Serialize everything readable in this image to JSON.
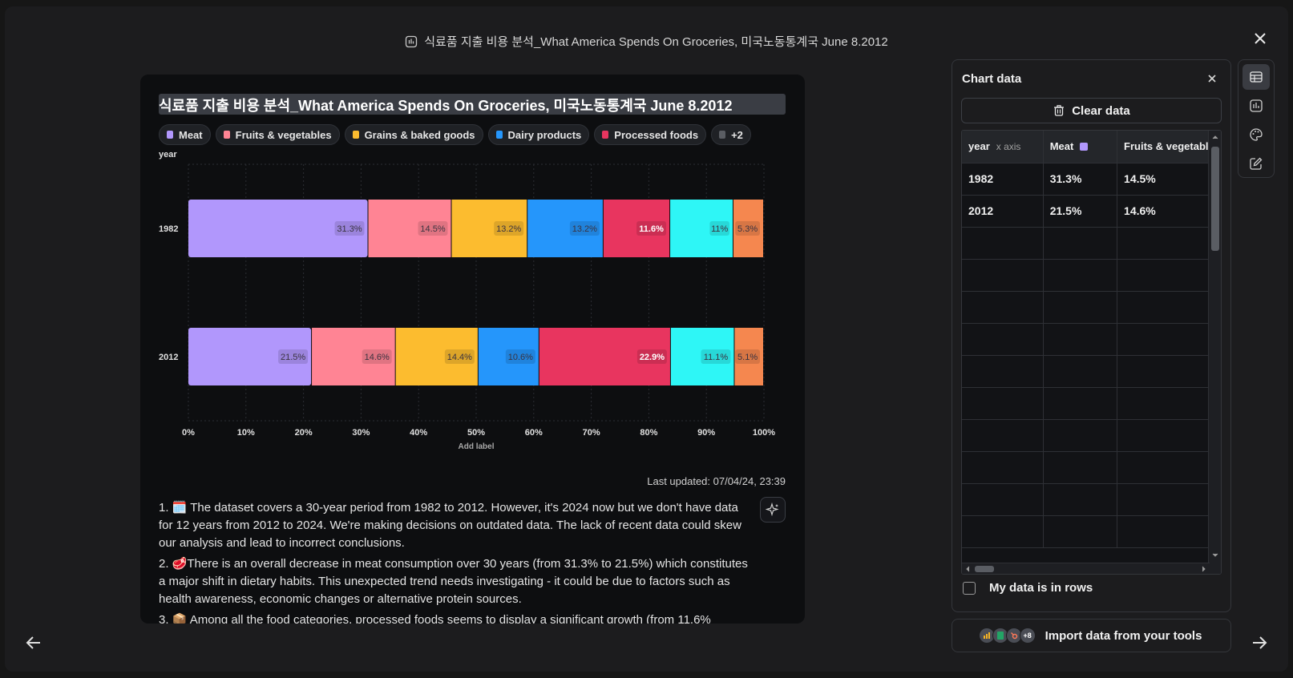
{
  "modal": {
    "title": "식료품 지출 비용 분석_What America Spends On Groceries, 미국노동통계국 June 8.2012"
  },
  "chart": {
    "title": "식료품 지출 비용 분석_What America Spends On Groceries, 미국노동통계국 June 8.2012",
    "legend_more": "+2",
    "last_updated": "Last updated: 07/04/24, 23:39"
  },
  "chart_data": {
    "type": "bar",
    "orientation": "horizontal",
    "stacked": true,
    "title": "식료품 지출 비용 분석_What America Spends On Groceries, 미국노동통계국 June 8.2012",
    "ylabel": "year",
    "xlabel": "Add label",
    "xlim": [
      0,
      100
    ],
    "x_ticks": [
      "0%",
      "10%",
      "20%",
      "30%",
      "40%",
      "50%",
      "60%",
      "70%",
      "80%",
      "90%",
      "100%"
    ],
    "grid": true,
    "categories": [
      "1982",
      "2012"
    ],
    "series": [
      {
        "name": "Meat",
        "color": "#b197fc",
        "values": [
          31.3,
          21.5
        ]
      },
      {
        "name": "Fruits & vegetables",
        "color": "#ff8494",
        "values": [
          14.5,
          14.6
        ]
      },
      {
        "name": "Grains & baked goods",
        "color": "#fcbc2f",
        "values": [
          13.2,
          14.4
        ]
      },
      {
        "name": "Dairy products",
        "color": "#2596fb",
        "values": [
          13.2,
          10.6
        ]
      },
      {
        "name": "Processed foods",
        "color": "#e8355f",
        "values": [
          11.6,
          22.9
        ]
      },
      {
        "name": "",
        "color": "#2ef6f6",
        "values": [
          11,
          11.1
        ]
      },
      {
        "name": "",
        "color": "#f5874f",
        "values": [
          5.3,
          5.1
        ]
      }
    ],
    "data_labels": [
      [
        "31.3%",
        "14.5%",
        "13.2%",
        "13.2%",
        "11.6%",
        "11%",
        "5.3%"
      ],
      [
        "21.5%",
        "14.6%",
        "14.4%",
        "10.6%",
        "22.9%",
        "11.1%",
        "5.1%"
      ]
    ]
  },
  "insights": [
    "1. 🗓️ The dataset covers a 30-year period from 1982 to 2012. However, it's 2024 now but we don't have data for 12 years from 2012 to 2024. We're making decisions on outdated data. The lack of recent data could skew our analysis and lead to incorrect conclusions.",
    "2. 🥩There is an overall decrease in meat consumption over 30 years (from 31.3% to 21.5%) which constitutes a major shift in dietary habits. This unexpected trend needs investigating - it could be due to factors such as health awareness, economic changes or alternative protein sources.",
    "3. 📦 Among all the food categories, processed foods seems to display a significant growth (from 11.6%"
  ],
  "panel": {
    "title": "Chart data",
    "clear_label": "Clear data",
    "headers": {
      "year": "year",
      "year_sub": "x axis",
      "meat": "Meat",
      "fruits": "Fruits & vegetables"
    },
    "rows": [
      {
        "year": "1982",
        "meat": "31.3%",
        "fruits": "14.5%"
      },
      {
        "year": "2012",
        "meat": "21.5%",
        "fruits": "14.6%"
      }
    ],
    "rows_label": "My data is in rows",
    "import_label": "Import data from your tools",
    "import_more": "+8"
  },
  "colors": {
    "accent": "#b197fc",
    "background": "#1c1c1e"
  }
}
